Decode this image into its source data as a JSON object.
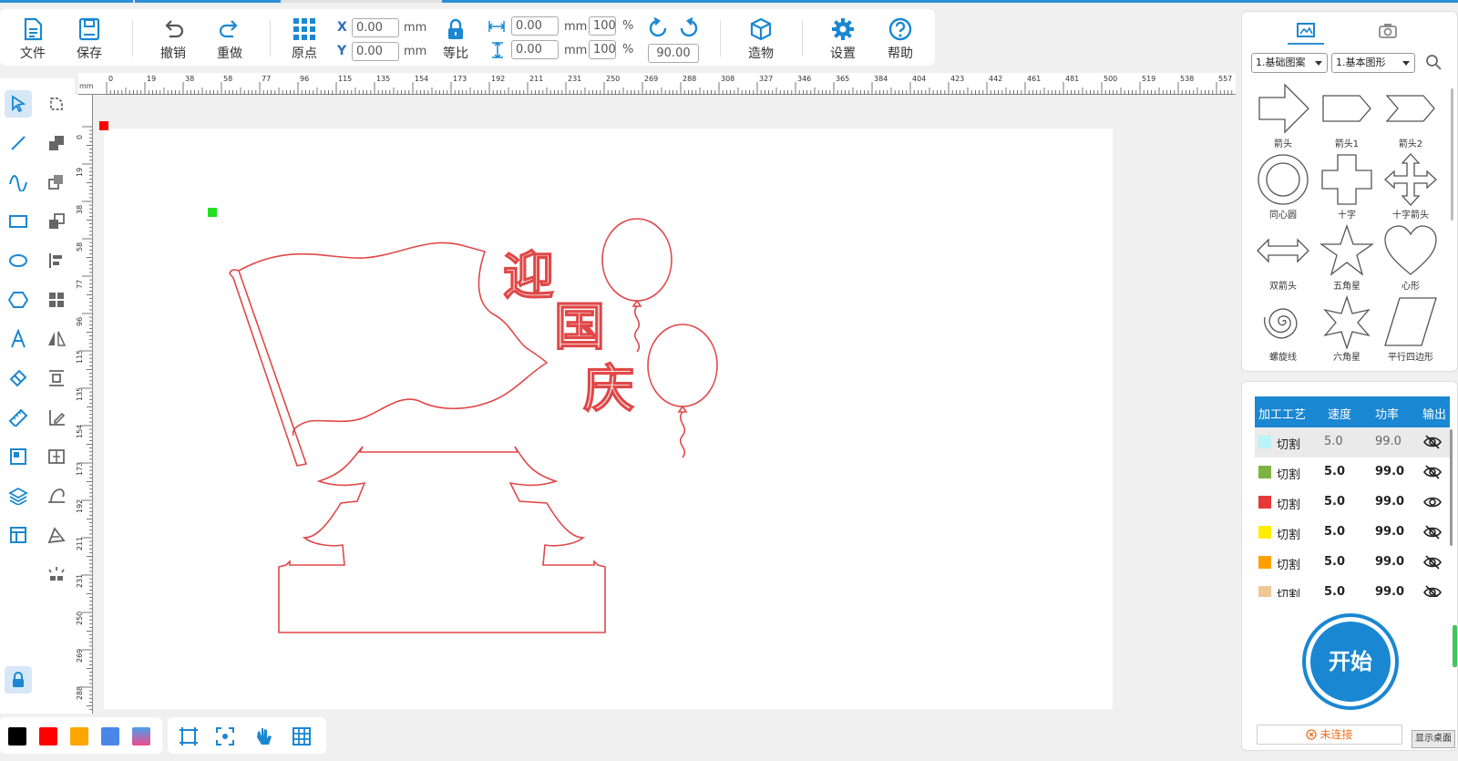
{
  "colors": {
    "accent": "#1a87d2",
    "design_stroke": "#e04848"
  },
  "toolbar": {
    "file": {
      "label": "文件",
      "icon": "file-icon"
    },
    "save": {
      "label": "保存",
      "icon": "save-icon"
    },
    "undo": {
      "label": "撤销",
      "icon": "undo-icon"
    },
    "redo": {
      "label": "重做",
      "icon": "redo-icon"
    },
    "origin": {
      "label": "原点",
      "icon": "grid-origin-icon"
    },
    "x_label": "X",
    "x_value": "0.00",
    "x_unit": "mm",
    "y_label": "Y",
    "y_value": "0.00",
    "y_unit": "mm",
    "ratio": {
      "label": "等比",
      "icon": "lock-icon"
    },
    "width_value": "0.00",
    "width_unit": "mm",
    "width_percent": "100",
    "width_percent_unit": "%",
    "height_value": "0.00",
    "height_unit": "mm",
    "height_percent": "100",
    "height_percent_unit": "%",
    "rotate_value": "90.00",
    "build": {
      "label": "造物",
      "icon": "box-icon"
    },
    "settings": {
      "label": "设置",
      "icon": "gear-icon"
    },
    "help": {
      "label": "帮助",
      "icon": "help-icon"
    }
  },
  "ruler": {
    "unit": "mm",
    "h_ticks": [
      "0",
      "19",
      "38",
      "58",
      "77",
      "96",
      "115",
      "135",
      "154",
      "173",
      "192",
      "211",
      "231",
      "250",
      "269",
      "288",
      "308",
      "327",
      "346",
      "365",
      "384",
      "404",
      "423",
      "442",
      "461",
      "481",
      "500",
      "519",
      "538",
      "557"
    ],
    "v_ticks": [
      "0",
      "19",
      "38",
      "58",
      "77",
      "96",
      "115",
      "135",
      "154",
      "173",
      "192",
      "211",
      "231",
      "250",
      "269",
      "288"
    ]
  },
  "canvas": {
    "design_text_1": "迎",
    "design_text_2": "国",
    "design_text_3": "庆"
  },
  "right_panel": {
    "category_select": "1.基础图案",
    "subcategory_select": "1.基本图形",
    "shapes": [
      "箭头",
      "箭头1",
      "箭头2",
      "同心圆",
      "十字",
      "十字箭头",
      "双箭头",
      "五角星",
      "心形",
      "螺旋线",
      "六角星",
      "平行四边形"
    ]
  },
  "layers": {
    "headers": [
      "加工工艺",
      "速度",
      "功率",
      "输出"
    ],
    "rows": [
      {
        "color": "#b8f4f8",
        "process": "切割",
        "speed": "5.0",
        "power": "99.0",
        "output": "eye-off-icon"
      },
      {
        "color": "#7cb342",
        "process": "切割",
        "speed": "5.0",
        "power": "99.0",
        "output": "eye-off-icon"
      },
      {
        "color": "#e53935",
        "process": "切割",
        "speed": "5.0",
        "power": "99.0",
        "output": "eye-icon"
      },
      {
        "color": "#ffee00",
        "process": "切割",
        "speed": "5.0",
        "power": "99.0",
        "output": "eye-off-icon"
      },
      {
        "color": "#ffa000",
        "process": "切割",
        "speed": "5.0",
        "power": "99.0",
        "output": "eye-off-icon"
      },
      {
        "color": "#f0c896",
        "process": "切割",
        "speed": "5.0",
        "power": "99.0",
        "output": "eye-off-icon"
      }
    ]
  },
  "start_button": "开始",
  "connection_status": "未连接",
  "desktop_tip": "显示桌面",
  "color_swatches": [
    "#000000",
    "#ff0000",
    "#ffa500",
    "#4a86e8",
    "gradient"
  ]
}
